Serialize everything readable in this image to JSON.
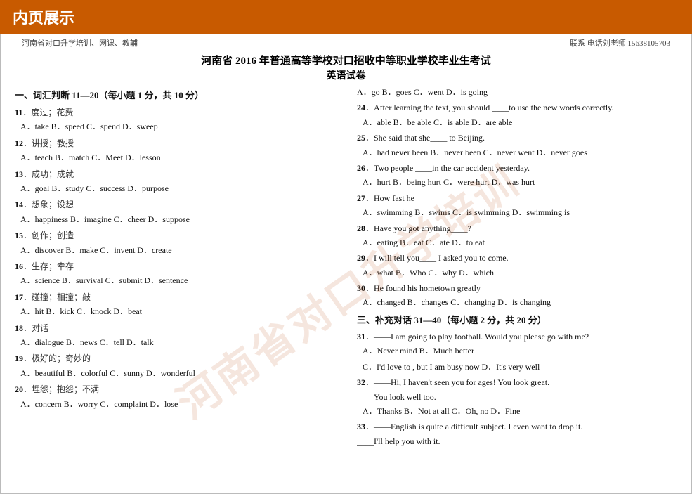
{
  "header": {
    "title": "内页展示"
  },
  "meta": {
    "left": "河南省对口升学培训、网课、教辅",
    "right": "联系 电话刘老师 15638105703"
  },
  "doc": {
    "title": "河南省 2016 年普通高等学校对口招收中等职业学校毕业生考试",
    "subtitle": "英语试卷",
    "section1": "一、词汇判断 11—20（每小题 1 分，共 10 分）",
    "questions_left": [
      {
        "num": "11",
        "zh": "度过；花费",
        "options": "A．take   B．speed   C．spend   D．sweep"
      },
      {
        "num": "12",
        "zh": "讲授；教授",
        "options": "A．teach   B．match   C．Meet   D．lesson"
      },
      {
        "num": "13",
        "zh": "成功；成就",
        "options": "A．goal   B．study   C．success   D．purpose"
      },
      {
        "num": "14",
        "zh": "想象；设想",
        "options": "A．happiness   B．imagine   C．cheer   D．suppose"
      },
      {
        "num": "15",
        "zh": "创作；创造",
        "options": "A．discover   B．make   C．invent   D．create"
      },
      {
        "num": "16",
        "zh": "生存；幸存",
        "options": "A．science   B．survival   C．submit   D．sentence"
      },
      {
        "num": "17",
        "zh": "碰撞；相撞；敲",
        "options": "A．hit      B．kick    C．knock   D．beat"
      },
      {
        "num": "18",
        "zh": "对话",
        "options": "A．dialogue   B．news   C．tell   D．talk"
      },
      {
        "num": "19",
        "zh": "极好的；奇妙的",
        "options": "A．beautiful   B．colorful   C．sunny   D．wonderful"
      },
      {
        "num": "20",
        "zh": "埋怨；抱怨；不满",
        "options": "A．concern   B．worry   C．complaint   D．lose"
      }
    ],
    "questions_right": [
      {
        "num": "",
        "text": "A．go   B．goes   C．went   D．is going",
        "options": ""
      },
      {
        "num": "24",
        "text": "After learning the text, you should ____to use the new words correctly.",
        "options": "A．able   B．be able   C．is able   D．are able"
      },
      {
        "num": "25",
        "text": "She said that she____ to Beijing.",
        "options": "A．had never been   B．never been   C．never went   D．never goes"
      },
      {
        "num": "26",
        "text": "Two people ____in the car accident yesterday.",
        "options": "A．hurt   B．being hurt   C．were hurt   D．was hurt"
      },
      {
        "num": "27",
        "text": "How fast he ______",
        "options": "A．swimming   B．swims   C．is swimming   D．swimming is"
      },
      {
        "num": "28",
        "text": "Have you got anything____?",
        "options": "A．eating   B．eat   C．ate   D．to eat"
      },
      {
        "num": "29",
        "text": "I will tell you____ I asked you to come.",
        "options": "A．what   B．Who   C．why   D．which"
      },
      {
        "num": "30",
        "text": "He found his hometown greatly",
        "options": "A．changed   B．changes   C．changing   D．is changing"
      }
    ],
    "section3": "三、补充对话 31—40（每小题 2 分，共 20 分）",
    "dialogues": [
      {
        "num": "31",
        "text": "——I am going to play football. Would you please go with me?",
        "options_line1": "A．Never mind              B．Much better",
        "options_line2": "C．I'd love to , but I am busy now   D．It's very well"
      },
      {
        "num": "32",
        "text": "——Hi, I haven't seen you for ages! You look great.",
        "blank": "____You look well too.",
        "options": "A．Thanks   B．Not at all   C．Oh, no   D．Fine"
      },
      {
        "num": "33",
        "text": "——English is quite a difficult subject. I even want to drop it.",
        "blank": "____I'll help you with it."
      }
    ]
  },
  "watermark": "河南省对口升学培训"
}
